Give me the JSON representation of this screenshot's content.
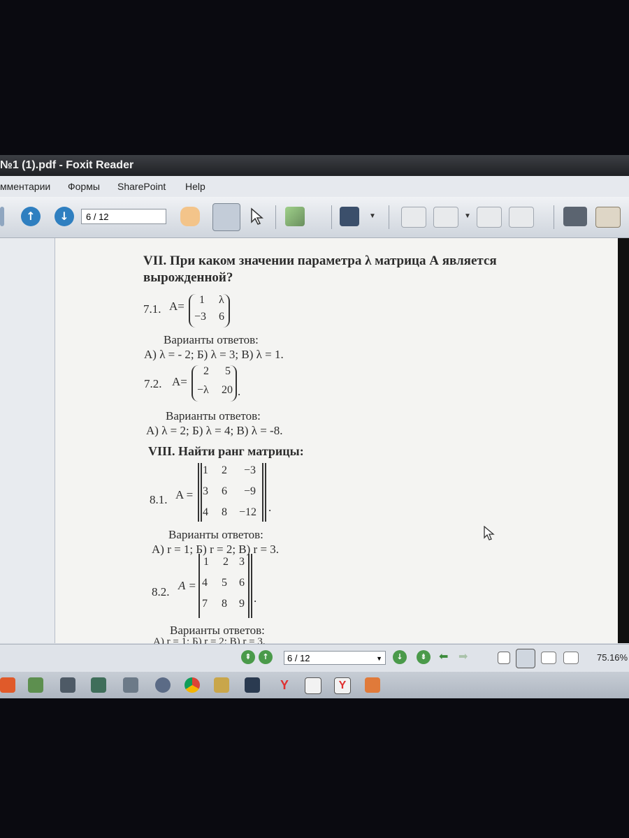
{
  "window": {
    "title": "№1 (1).pdf - Foxit Reader"
  },
  "menu": {
    "items": [
      "мментарии",
      "Формы",
      "SharePoint",
      "Help"
    ]
  },
  "toolbar": {
    "page_indicator": "6 / 12"
  },
  "document": {
    "section7_title_line1": "VII.  При  каком  значении  параметра  λ  матрица  А  является",
    "section7_title_line2": "вырожденной?",
    "p71_label": "7.1.",
    "p71_prefix": "A=",
    "p71_matrix": [
      [
        "1",
        "λ"
      ],
      [
        "−3",
        "6"
      ]
    ],
    "p71_variants_heading": "Варианты ответов:",
    "p71_answers": "А) λ = - 2; Б) λ = 3; В) λ = 1.",
    "p72_label": "7.2.",
    "p72_prefix": "A=",
    "p72_matrix": [
      [
        "2",
        "5"
      ],
      [
        "−λ",
        "20"
      ]
    ],
    "p72_suffix": ".",
    "p72_variants_heading": "Варианты ответов:",
    "p72_answers": "А) λ = 2; Б) λ = 4; В) λ = -8.",
    "section8_title": "VIII. Найти ранг матрицы:",
    "p81_label": "8.1.",
    "p81_prefix": "A =",
    "p81_matrix": [
      [
        "1",
        "2",
        "−3"
      ],
      [
        "3",
        "6",
        "−9"
      ],
      [
        "4",
        "8",
        "−12"
      ]
    ],
    "p81_suffix": ".",
    "p81_variants_heading": "Варианты ответов:",
    "p81_answers": "А) r = 1; Б) r = 2; В) r = 3.",
    "p82_label": "8.2.",
    "p82_prefix": "A =",
    "p82_matrix": [
      [
        "1",
        "2",
        "3"
      ],
      [
        "4",
        "5",
        "6"
      ],
      [
        "7",
        "8",
        "9"
      ]
    ],
    "p82_suffix": ".",
    "p82_variants_heading": "Варианты ответов:",
    "p82_answers": "А) r = 1; Б) r = 2; В) r = 3."
  },
  "statusbar": {
    "page_indicator": "6 / 12",
    "zoom": "75.16%"
  },
  "taskbar": {
    "icons": [
      "foxit-icon",
      "app-icon",
      "app-icon",
      "app-icon",
      "app-icon",
      "chrome-icon",
      "app-icon",
      "wifi-icon",
      "yandex-icon",
      "document-icon",
      "yandex-icon",
      "pdf-icon"
    ]
  },
  "colors": {
    "accent": "#2f7fc0",
    "titlebar": "#2a2c30",
    "page": "#f4f4f2"
  }
}
